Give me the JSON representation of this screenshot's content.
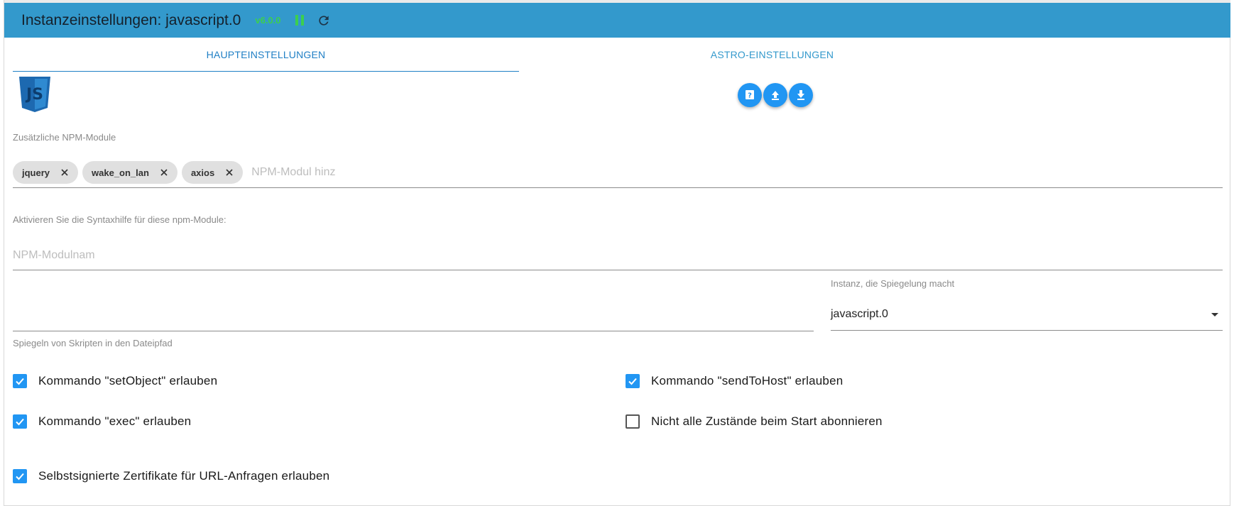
{
  "header": {
    "title": "Instanzeinstellungen: javascript.0",
    "version": "v6.0.0",
    "colors": {
      "bar": "#3399cc",
      "version": "#3ccf4e"
    }
  },
  "tabs": [
    {
      "label": "HAUPTEINSTELLUNGEN",
      "active": true
    },
    {
      "label": "ASTRO-EINSTELLUNGEN",
      "active": false
    }
  ],
  "logo": {
    "icon": "javascript-logo-icon",
    "text": "JS"
  },
  "actions": [
    {
      "icon": "help-icon"
    },
    {
      "icon": "upload-icon"
    },
    {
      "icon": "download-icon"
    }
  ],
  "npm_modules": {
    "label": "Zusätzliche NPM-Module",
    "chips": [
      "jquery",
      "wake_on_lan",
      "axios"
    ],
    "placeholder": "NPM-Modul hinz"
  },
  "syntax_help": {
    "label": "Aktivieren Sie die Syntaxhilfe für diese npm-Module:",
    "placeholder": "NPM-Modulnam"
  },
  "mirror": {
    "path_label": "Spiegeln von Skripten in den Dateipfad",
    "path_value": "",
    "instance_label": "Instanz, die Spiegelung macht",
    "instance_value": "javascript.0"
  },
  "checkboxes": {
    "set_object": {
      "label": "Kommando \"setObject\" erlauben",
      "checked": true
    },
    "send_to_host": {
      "label": "Kommando \"sendToHost\" erlauben",
      "checked": true
    },
    "exec": {
      "label": "Kommando \"exec\" erlauben",
      "checked": true
    },
    "no_subscribe": {
      "label": "Nicht alle Zustände beim Start abonnieren",
      "checked": false
    },
    "self_signed": {
      "label": "Selbstsignierte Zertifikate für URL-Anfragen erlauben",
      "checked": true
    }
  }
}
